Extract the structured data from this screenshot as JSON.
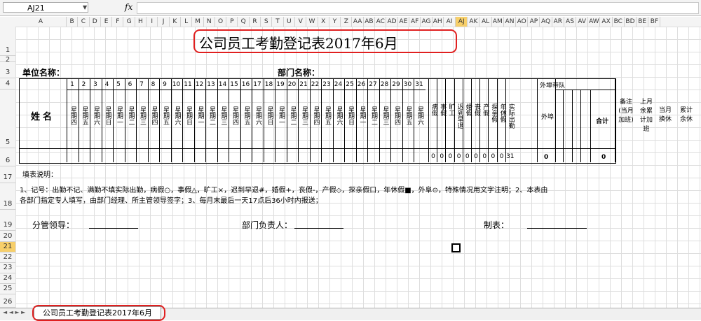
{
  "formula_bar": {
    "name_box": "AJ21",
    "fx": "fx",
    "formula": ""
  },
  "columns": [
    "A",
    "B",
    "C",
    "D",
    "E",
    "F",
    "G",
    "H",
    "I",
    "J",
    "K",
    "L",
    "M",
    "N",
    "O",
    "P",
    "Q",
    "R",
    "S",
    "T",
    "U",
    "V",
    "W",
    "X",
    "Y",
    "Z",
    "AA",
    "AB",
    "AC",
    "AD",
    "AE",
    "AF",
    "AG",
    "AH",
    "AI",
    "AJ",
    "AK",
    "AL",
    "AM",
    "AN",
    "AO",
    "AP",
    "AQ",
    "AR",
    "AS",
    "AV",
    "AW",
    "AX",
    "BC",
    "BD",
    "BE",
    "BF"
  ],
  "selected_column": "AJ",
  "rows": [
    "1",
    "2",
    "3",
    "4",
    "5",
    "6",
    "17",
    "18",
    "19",
    "20",
    "21",
    "22",
    "23",
    "24",
    "25",
    "26"
  ],
  "selected_row": "21",
  "sheet": {
    "title": "公司员工考勤登记表2017年6月",
    "unit_label": "单位名称：",
    "dept_label": "部门名称：",
    "name_header": "姓名",
    "days": [
      "1",
      "2",
      "3",
      "4",
      "5",
      "6",
      "7",
      "8",
      "9",
      "10",
      "11",
      "12",
      "13",
      "14",
      "15",
      "16",
      "17",
      "18",
      "19",
      "20",
      "21",
      "22",
      "23",
      "24",
      "25",
      "26",
      "27",
      "28",
      "29",
      "30",
      "31"
    ],
    "weekdays": [
      "星期四",
      "星期五",
      "星期六",
      "星期日",
      "星期一",
      "星期二",
      "星期三",
      "星期四",
      "星期五",
      "星期六",
      "星期日",
      "星期一",
      "星期二",
      "星期三",
      "星期四",
      "星期五",
      "星期六",
      "星期日",
      "星期一",
      "星期二",
      "星期三",
      "星期四",
      "星期五",
      "星期六",
      "星期日",
      "星期一",
      "星期二",
      "星期三",
      "星期四",
      "星期五",
      "星期六"
    ],
    "leave_headers": [
      "病假",
      "事假",
      "旷工",
      "迟到早退",
      "婚假",
      "丧假",
      "产假",
      "探亲假",
      "年休假",
      "实际出勤"
    ],
    "outside": "外埠",
    "outside_team": "外埠带队",
    "total": "合计",
    "remarks": [
      "备注(当月加班)",
      "上月余累计加班",
      "当月换休",
      "累计余休"
    ],
    "row6_values": [
      "0",
      "0",
      "0",
      "0",
      "0",
      "0",
      "0",
      "0",
      "0",
      "31"
    ],
    "row6_outside": "0",
    "row6_total": "0",
    "notes_title": "填表说明：",
    "notes_line1": "1、记号：出勤不记、满勤不填实际出勤，病假○，事假△，旷工×，迟到早退#，婚假+，丧假-，产假◇，探亲假口，年休假■，外阜⊙，特殊情况用文字注明；2、本表由",
    "notes_line2": "各部门指定专人填写，由部门经理、所主管领导签字；3、每月末最后一天17点后36小时内报送；",
    "sign1": "分管领导：",
    "sign2": "部门负责人：",
    "sign3": "制表："
  },
  "tab": {
    "name": "公司员工考勤登记表2017年6月"
  },
  "accent": "#e02020",
  "selection_color": "#f7cf6a"
}
